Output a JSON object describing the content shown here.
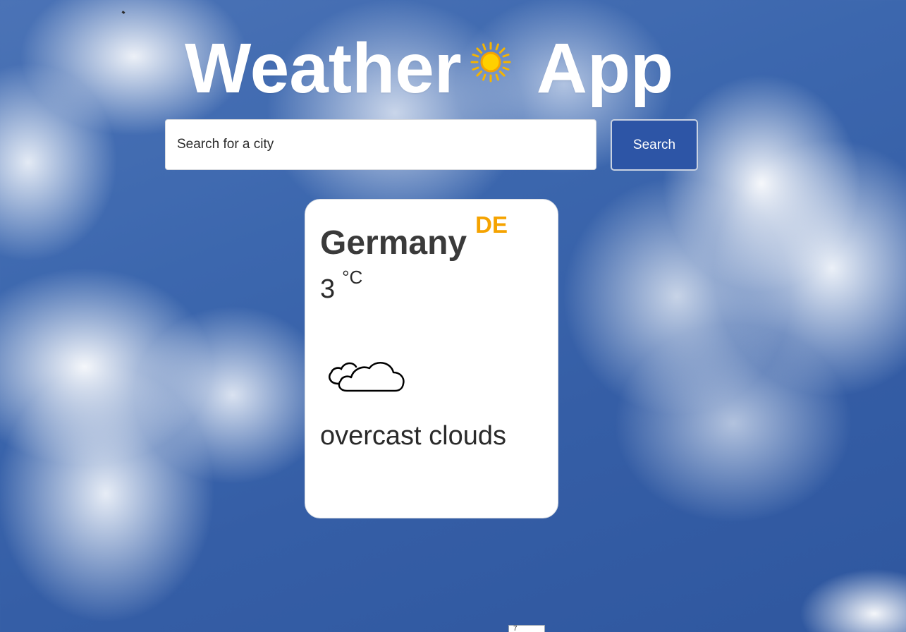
{
  "header": {
    "title_left": "Weather",
    "title_right": "App",
    "title_icon": "sun-icon"
  },
  "search": {
    "placeholder": "Search for a city",
    "value": "",
    "button_label": "Search"
  },
  "weather_card": {
    "city": "Germany",
    "country_code": "DE",
    "temperature": "3",
    "unit": "°C",
    "condition_icon": "clouds-icon",
    "description": "overcast clouds"
  },
  "bottom_tab": {
    "label": "7"
  },
  "colors": {
    "accent_button": "#2d55a6",
    "country_code": "#f5a300",
    "card_background": "#ffffff",
    "title_text": "#ffffff"
  }
}
